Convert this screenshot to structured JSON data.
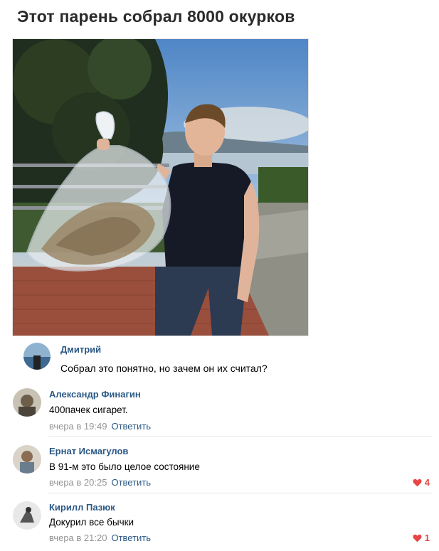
{
  "post": {
    "title": "Этот парень собрал 8000 окурков"
  },
  "first_comment": {
    "author": "Дмитрий",
    "text": "Собрал это понятно, но зачем он их считал?"
  },
  "comments": [
    {
      "author": "Александр Финагин",
      "text": "400пачек сигарет.",
      "time": "вчера в 19:49",
      "reply": "Ответить",
      "likes": ""
    },
    {
      "author": "Ернат Исмагулов",
      "text": "В 91-м это было целое состояние",
      "time": "вчера в 20:25",
      "reply": "Ответить",
      "likes": "4"
    },
    {
      "author": "Кирилл Пазюк",
      "text": "Докурил все бычки",
      "time": "вчера в 21:20",
      "reply": "Ответить",
      "likes": "1"
    }
  ],
  "colors": {
    "link": "#2a5885",
    "like": "#e64646",
    "meta": "#939393"
  }
}
